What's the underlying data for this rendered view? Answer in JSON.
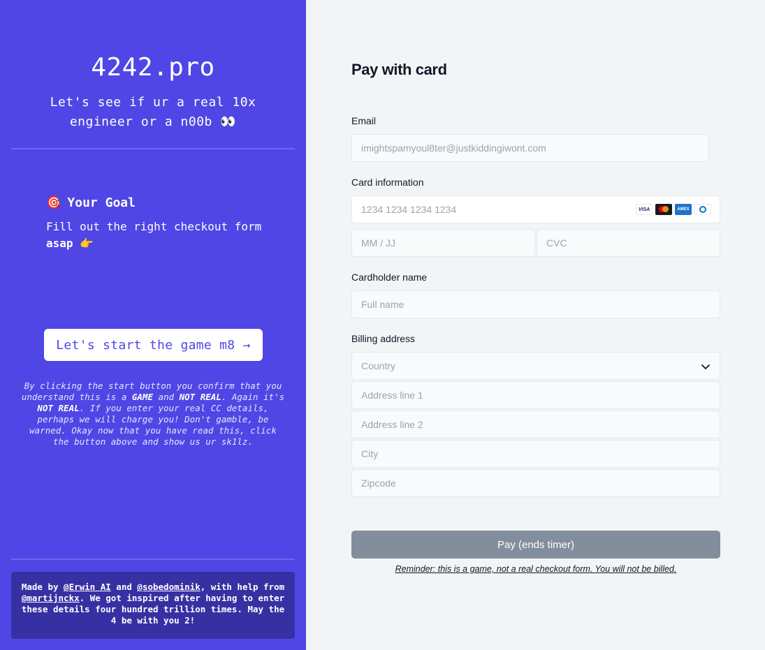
{
  "left": {
    "brand": "4242.pro",
    "tagline": "Let's see if ur a real 10x engineer or a n00b 👀",
    "goal": {
      "icon": "🎯",
      "title": "Your Goal",
      "text_prefix": "Fill out the right checkout form ",
      "text_bold": "asap",
      "text_suffix": " 👉"
    },
    "start_button": "Let's start the game m8 →",
    "disclaimer": {
      "p1": "By clicking the start button you confirm that you understand this is a ",
      "b1": "GAME",
      "p2": " and ",
      "b2": "NOT REAL",
      "p3": ". Again it's ",
      "b3": "NOT REAL",
      "p4": ". If you enter your real CC details, perhaps we will charge you! Don't gamble, be warned. Okay now that you have read this, click the button above and show us ur sk1lz."
    },
    "credits": {
      "p1": "Made by ",
      "link1": "@Erwin AI",
      "p2": " and ",
      "link2": "@sobedominik",
      "p3": ", with help from ",
      "link3": "@martijnckx",
      "p4": ". We got inspired after having to enter these details four hundred trillion times. May the 4 be with you 2!"
    }
  },
  "form": {
    "title": "Pay with card",
    "email_label": "Email",
    "email_placeholder": "imightspamyoul8ter@justkiddingiwont.com",
    "card_label": "Card information",
    "card_placeholder": "1234 1234 1234 1234",
    "card_brands": [
      "VISA",
      "mastercard",
      "AMEX",
      "diners"
    ],
    "expiry_placeholder": "MM / JJ",
    "cvc_placeholder": "CVC",
    "name_label": "Cardholder name",
    "name_placeholder": "Full name",
    "billing_label": "Billing address",
    "country_placeholder": "Country",
    "address1_placeholder": "Address line 1",
    "address2_placeholder": "Address line 2",
    "city_placeholder": "City",
    "zip_placeholder": "Zipcode",
    "pay_button": "Pay (ends timer)",
    "reminder": "Reminder: this is a game, not a real checkout form. You will not be billed."
  },
  "colors": {
    "accent": "#4f46e5",
    "accent_dark": "#3730a3",
    "pay_button": "#838e9c"
  }
}
